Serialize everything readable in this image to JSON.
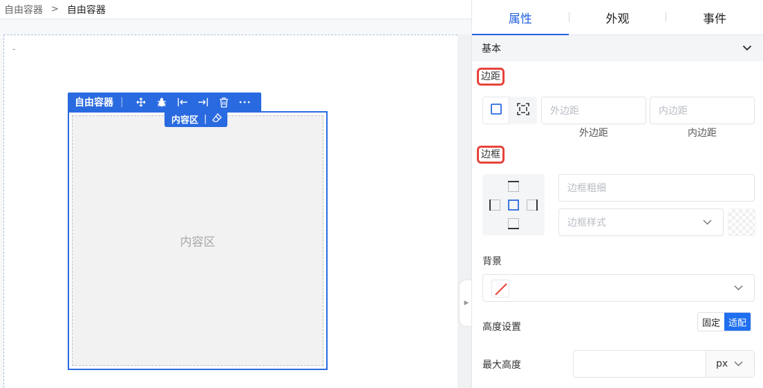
{
  "breadcrumb": {
    "items": [
      "自由容器",
      "自由容器"
    ],
    "separator": ">"
  },
  "canvas": {
    "marker": "-",
    "container": {
      "title": "自由容器",
      "toolbar_icons": [
        "move-icon",
        "bug-icon",
        "align-left-icon",
        "align-right-icon",
        "trash-icon",
        "more-icon"
      ]
    },
    "content_tag": "内容区",
    "content_placeholder": "内容区"
  },
  "panel": {
    "tabs": [
      {
        "label": "属性",
        "active": true
      },
      {
        "label": "外观",
        "active": false
      },
      {
        "label": "事件",
        "active": false
      }
    ],
    "section": {
      "title": "基本"
    },
    "spacing": {
      "label": "边距",
      "outer_placeholder": "外边距",
      "inner_placeholder": "内边距",
      "outer_caption": "外边距",
      "inner_caption": "内边距"
    },
    "border": {
      "label": "边框",
      "width_placeholder": "边框粗细",
      "style_placeholder": "边框样式"
    },
    "background": {
      "label": "背景"
    },
    "height": {
      "label": "高度设置",
      "options": [
        "固定",
        "适配"
      ],
      "selected": "适配"
    },
    "max_height": {
      "label": "最大高度",
      "unit": "px"
    }
  },
  "colors": {
    "accent": "#2a6ae0",
    "highlight": "#e6433b",
    "toggle_active": "#1f6ff0"
  }
}
